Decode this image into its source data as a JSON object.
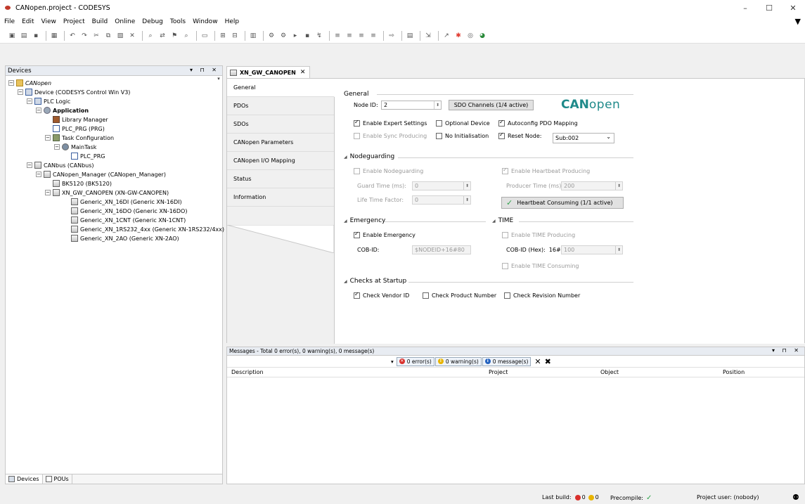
{
  "window": {
    "title": "CANopen.project - CODESYS",
    "minimize": "–",
    "maximize": "☐",
    "close": "✕"
  },
  "menu": [
    "File",
    "Edit",
    "View",
    "Project",
    "Build",
    "Online",
    "Debug",
    "Tools",
    "Window",
    "Help"
  ],
  "devices_panel": {
    "title": "Devices",
    "controls": "▾ ⊓ ✕",
    "tree": [
      {
        "label": "CANopen",
        "italic": true
      },
      {
        "label": "Device (CODESYS Control Win V3)"
      },
      {
        "label": "PLC Logic"
      },
      {
        "label": "Application",
        "bold": true
      },
      {
        "label": "Library Manager"
      },
      {
        "label": "PLC_PRG (PRG)"
      },
      {
        "label": "Task Configuration"
      },
      {
        "label": "MainTask"
      },
      {
        "label": "PLC_PRG"
      },
      {
        "label": "CANbus (CANbus)"
      },
      {
        "label": "CANopen_Manager (CANopen_Manager)"
      },
      {
        "label": "BK5120 (BK5120)"
      },
      {
        "label": "XN_GW_CANOPEN (XN-GW-CANOPEN)"
      },
      {
        "label": "Generic_XN_16DI (Generic XN-16DI)"
      },
      {
        "label": "Generic_XN_16DO (Generic XN-16DO)"
      },
      {
        "label": "Generic_XN_1CNT (Generic XN-1CNT)"
      },
      {
        "label": "Generic_XN_1RS232_4xx (Generic XN-1RS232/4xx)"
      },
      {
        "label": "Generic_XN_2AO (Generic XN-2AO)"
      }
    ],
    "bottom_tabs": [
      "Devices",
      "POUs"
    ]
  },
  "editor": {
    "tab_title": "XN_GW_CANOPEN",
    "side_tabs": [
      "General",
      "PDOs",
      "SDOs",
      "CANopen Parameters",
      "CANopen I/O Mapping",
      "Status",
      "Information"
    ],
    "general": {
      "title": "General",
      "node_id_label": "Node ID:",
      "node_id_value": "2",
      "sdo_channels_button": "SDO Channels (1/4 active)",
      "logo_bold": "CAN",
      "logo_light": "open",
      "enable_expert": "Enable Expert Settings",
      "optional_device": "Optional Device",
      "autoconfig_pdo": "Autoconfig PDO Mapping",
      "enable_sync": "Enable Sync Producing",
      "no_initialisation": "No Initialisation",
      "reset_node": "Reset Node:",
      "reset_node_value": "Sub:002"
    },
    "nodeguarding": {
      "title": "Nodeguarding",
      "enable_nodeguarding": "Enable Nodeguarding",
      "enable_heartbeat": "Enable Heartbeat Producing",
      "guard_time_label": "Guard Time (ms):",
      "guard_time_value": "0",
      "producer_time_label": "Producer Time (ms):",
      "producer_time_value": "200",
      "life_time_label": "Life Time Factor:",
      "life_time_value": "0",
      "heartbeat_consuming": "Heartbeat Consuming (1/1 active)"
    },
    "emergency": {
      "title": "Emergency",
      "enable_emergency": "Enable Emergency",
      "cob_id_label": "COB-ID:",
      "cob_id_value": "$NODEID+16#80"
    },
    "time": {
      "title": "TIME",
      "enable_time_producing": "Enable TIME Producing",
      "cob_id_hex_label": "COB-ID (Hex):",
      "hex_prefix": "16#",
      "cob_id_hex_value": "100",
      "enable_time_consuming": "Enable TIME Consuming"
    },
    "checks": {
      "title": "Checks at Startup",
      "check_vendor": "Check Vendor ID",
      "check_product": "Check Product Number",
      "check_revision": "Check Revision Number"
    }
  },
  "messages": {
    "header": "Messages - Total 0 error(s), 0 warning(s), 0 message(s)",
    "errors": "0 error(s)",
    "warnings": "0 warning(s)",
    "msgs": "0 message(s)",
    "columns": [
      "Description",
      "Project",
      "Object",
      "Position"
    ]
  },
  "statusbar": {
    "last_build": "Last build:",
    "err_count": "0",
    "warn_count": "0",
    "precompile": "Precompile:",
    "project_user": "Project user: (nobody)"
  },
  "colors": {
    "accent": "#1f8a8a",
    "error": "#d9302c",
    "warning": "#e8b400",
    "info": "#2563c0",
    "ok": "#2ea34a"
  }
}
